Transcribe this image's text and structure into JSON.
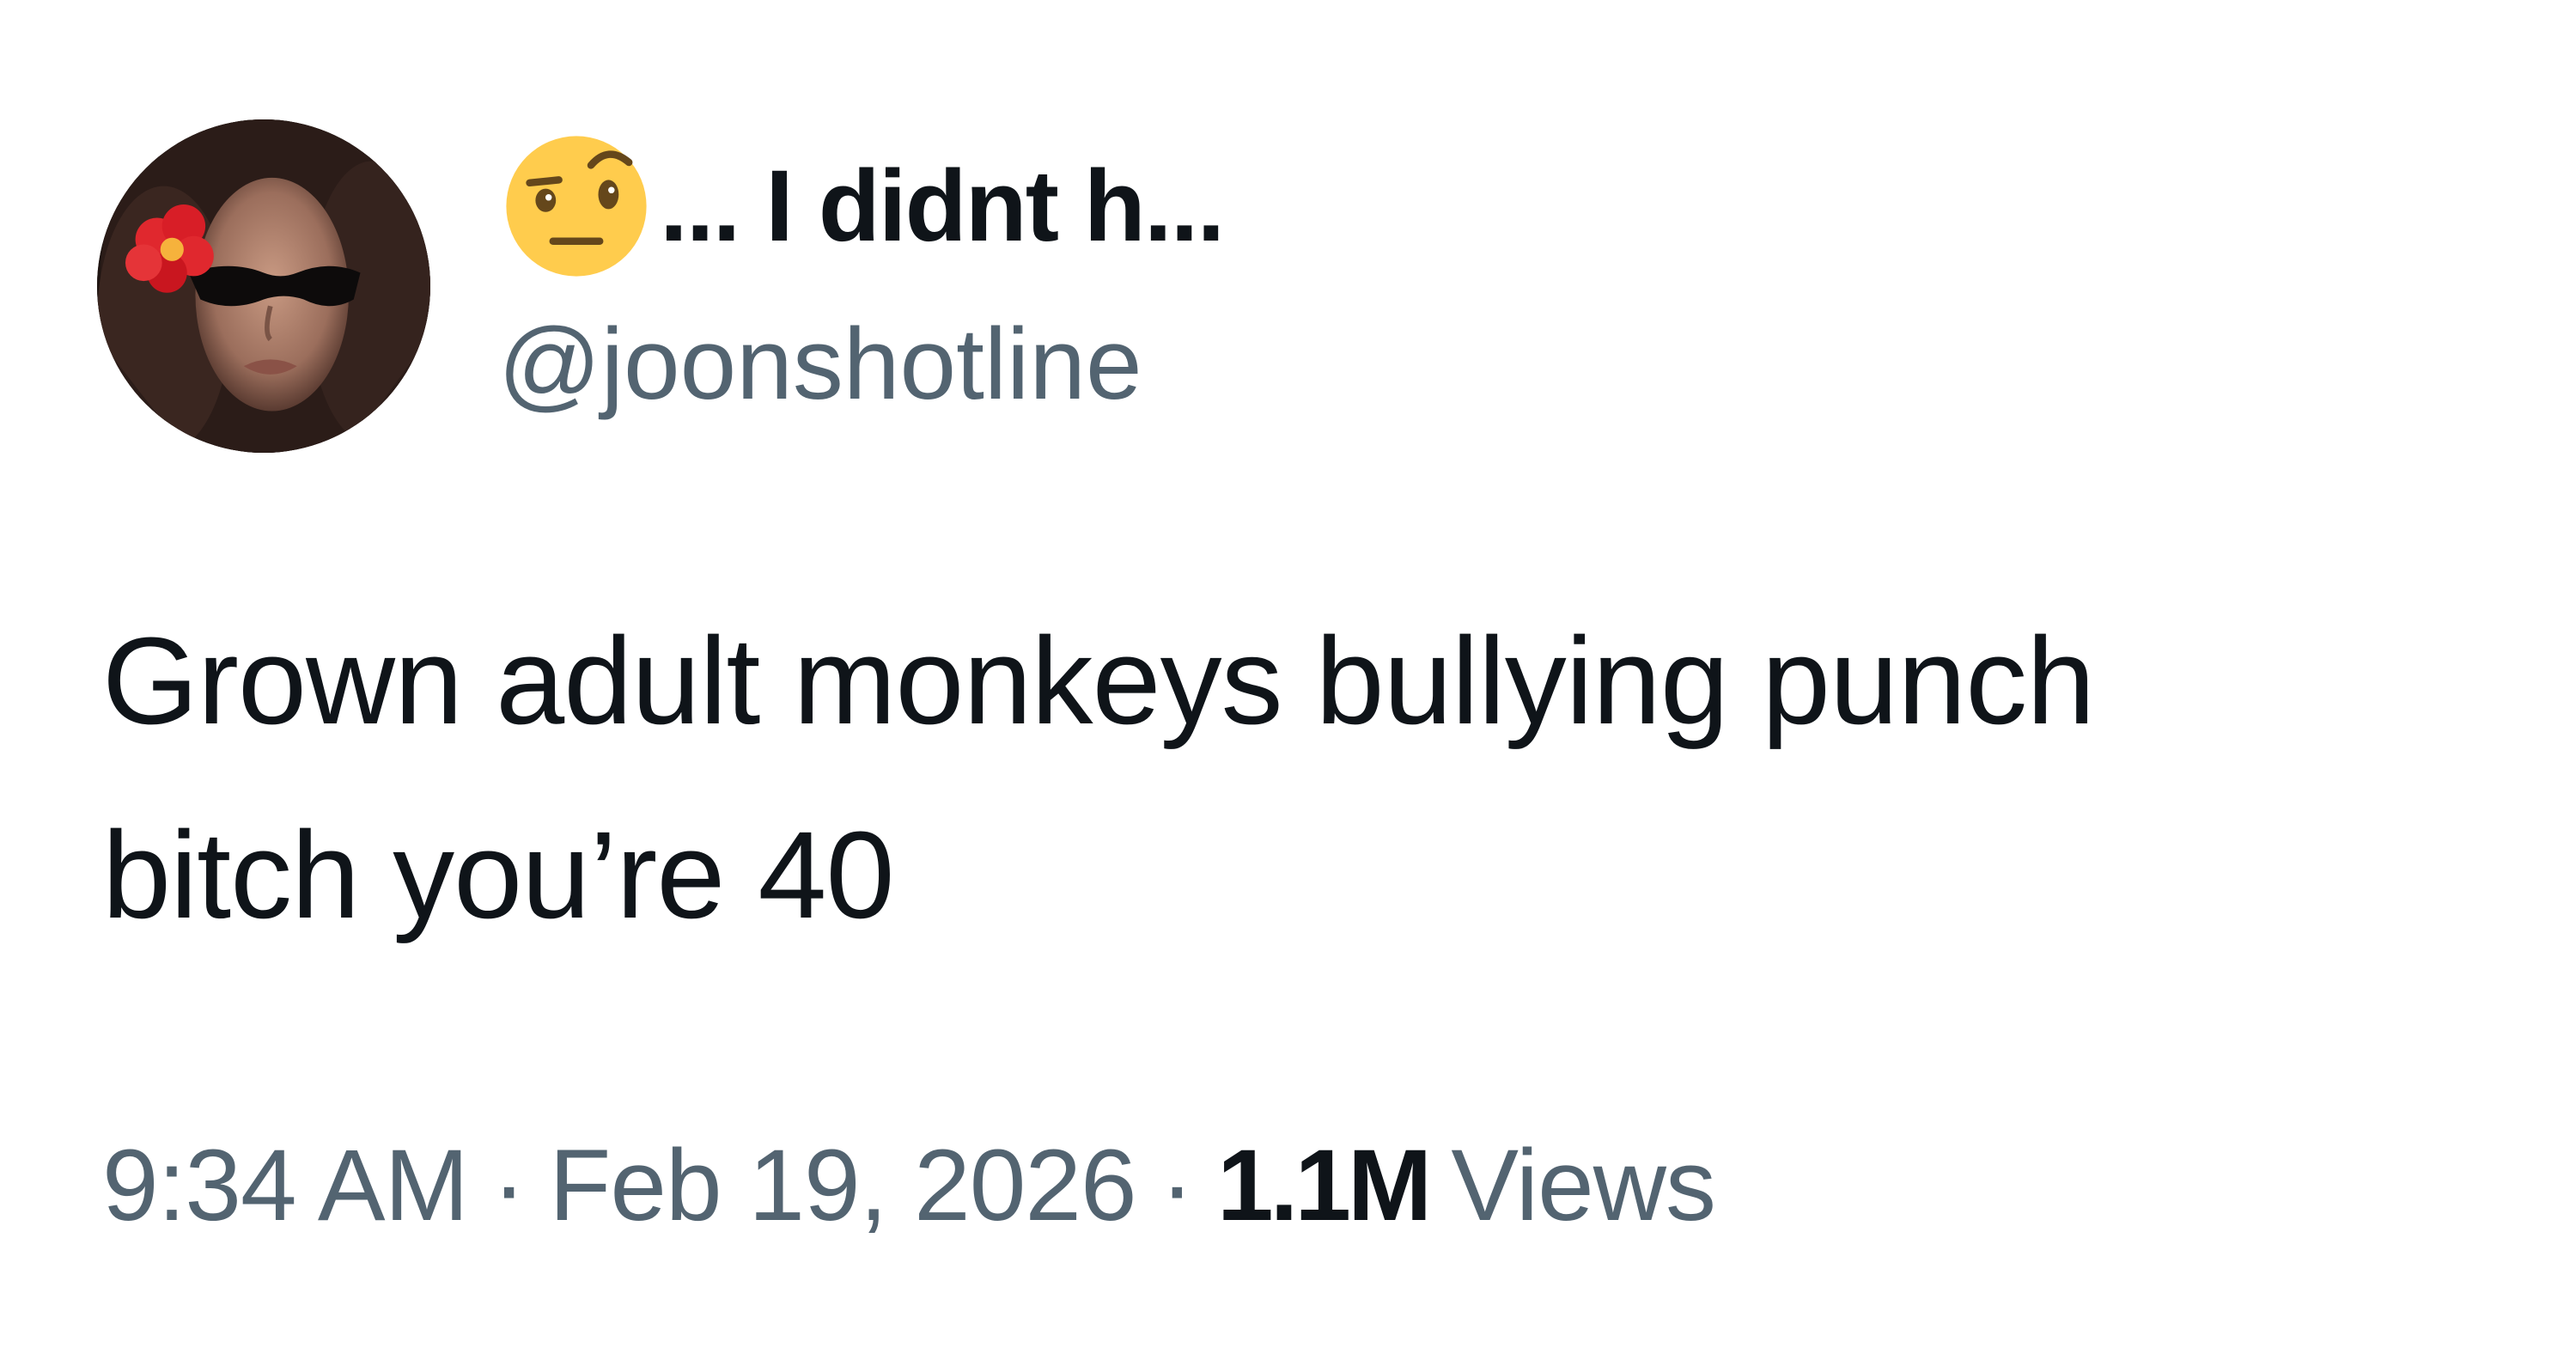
{
  "author": {
    "avatar_icon": "profile-photo-woman-sunglasses-red-flower",
    "display_emoji_icon": "face-with-raised-eyebrow-emoji",
    "display_name": "... I didnt h...",
    "handle": "@joonshotline"
  },
  "tweet": {
    "text_line_1": "Grown adult monkeys bullying punch",
    "text_line_2": "bitch you’re 40"
  },
  "meta": {
    "time": "9:34 AM",
    "separator": "·",
    "date": "Feb 19, 2026",
    "views_count": "1.1M",
    "views_label": "Views"
  },
  "colors": {
    "primary_text": "#0f1419",
    "secondary_text": "#536471",
    "emoji_yellow": "#FFCC4D",
    "flower_red": "#E0282E"
  }
}
